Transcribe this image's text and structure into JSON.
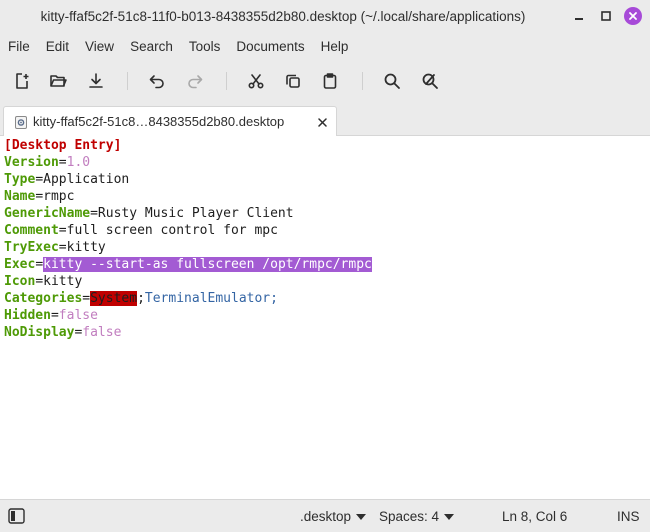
{
  "window": {
    "title": "kitty-ffaf5c2f-51c8-11f0-b013-8438355d2b80.desktop (~/.local/share/applications)"
  },
  "menu": [
    "File",
    "Edit",
    "View",
    "Search",
    "Tools",
    "Documents",
    "Help"
  ],
  "toolbar": {
    "buttons": [
      "new-document",
      "open",
      "save",
      "undo",
      "redo",
      "cut",
      "copy",
      "paste",
      "find",
      "find-replace"
    ]
  },
  "tab": {
    "label": "kitty-ffaf5c2f-51c8…8438355d2b80.desktop"
  },
  "editor": {
    "group_header": "[Desktop Entry]",
    "lines": [
      {
        "key": "Version",
        "value": "1.0"
      },
      {
        "key": "Type",
        "value": "Application"
      },
      {
        "key": "Name",
        "value": "rmpc"
      },
      {
        "key": "GenericName",
        "value": "Rusty Music Player Client"
      },
      {
        "key": "Comment",
        "value": "full screen control for mpc"
      },
      {
        "key": "TryExec",
        "value": "kitty"
      },
      {
        "key": "Exec",
        "value": "kitty --start-as fullscreen /opt/rmpc/rmpc"
      },
      {
        "key": "Icon",
        "value": "kitty"
      },
      {
        "key": "Categories",
        "value_part1": "System",
        "sep": ";",
        "value_part2": "TerminalEmulator",
        "trail": ";"
      },
      {
        "key": "Hidden",
        "value": "false"
      },
      {
        "key": "NoDisplay",
        "value": "false"
      }
    ]
  },
  "status": {
    "language": ".desktop",
    "spaces": "Spaces: 4",
    "position": "Ln 8, Col 6",
    "mode": "INS"
  },
  "colors": {
    "accent": "#a74ad8",
    "selection": "#a35bd3",
    "key": "#4e9a06",
    "group": "#c00000",
    "literal": "#c17dbf",
    "category": "#3465a4"
  }
}
